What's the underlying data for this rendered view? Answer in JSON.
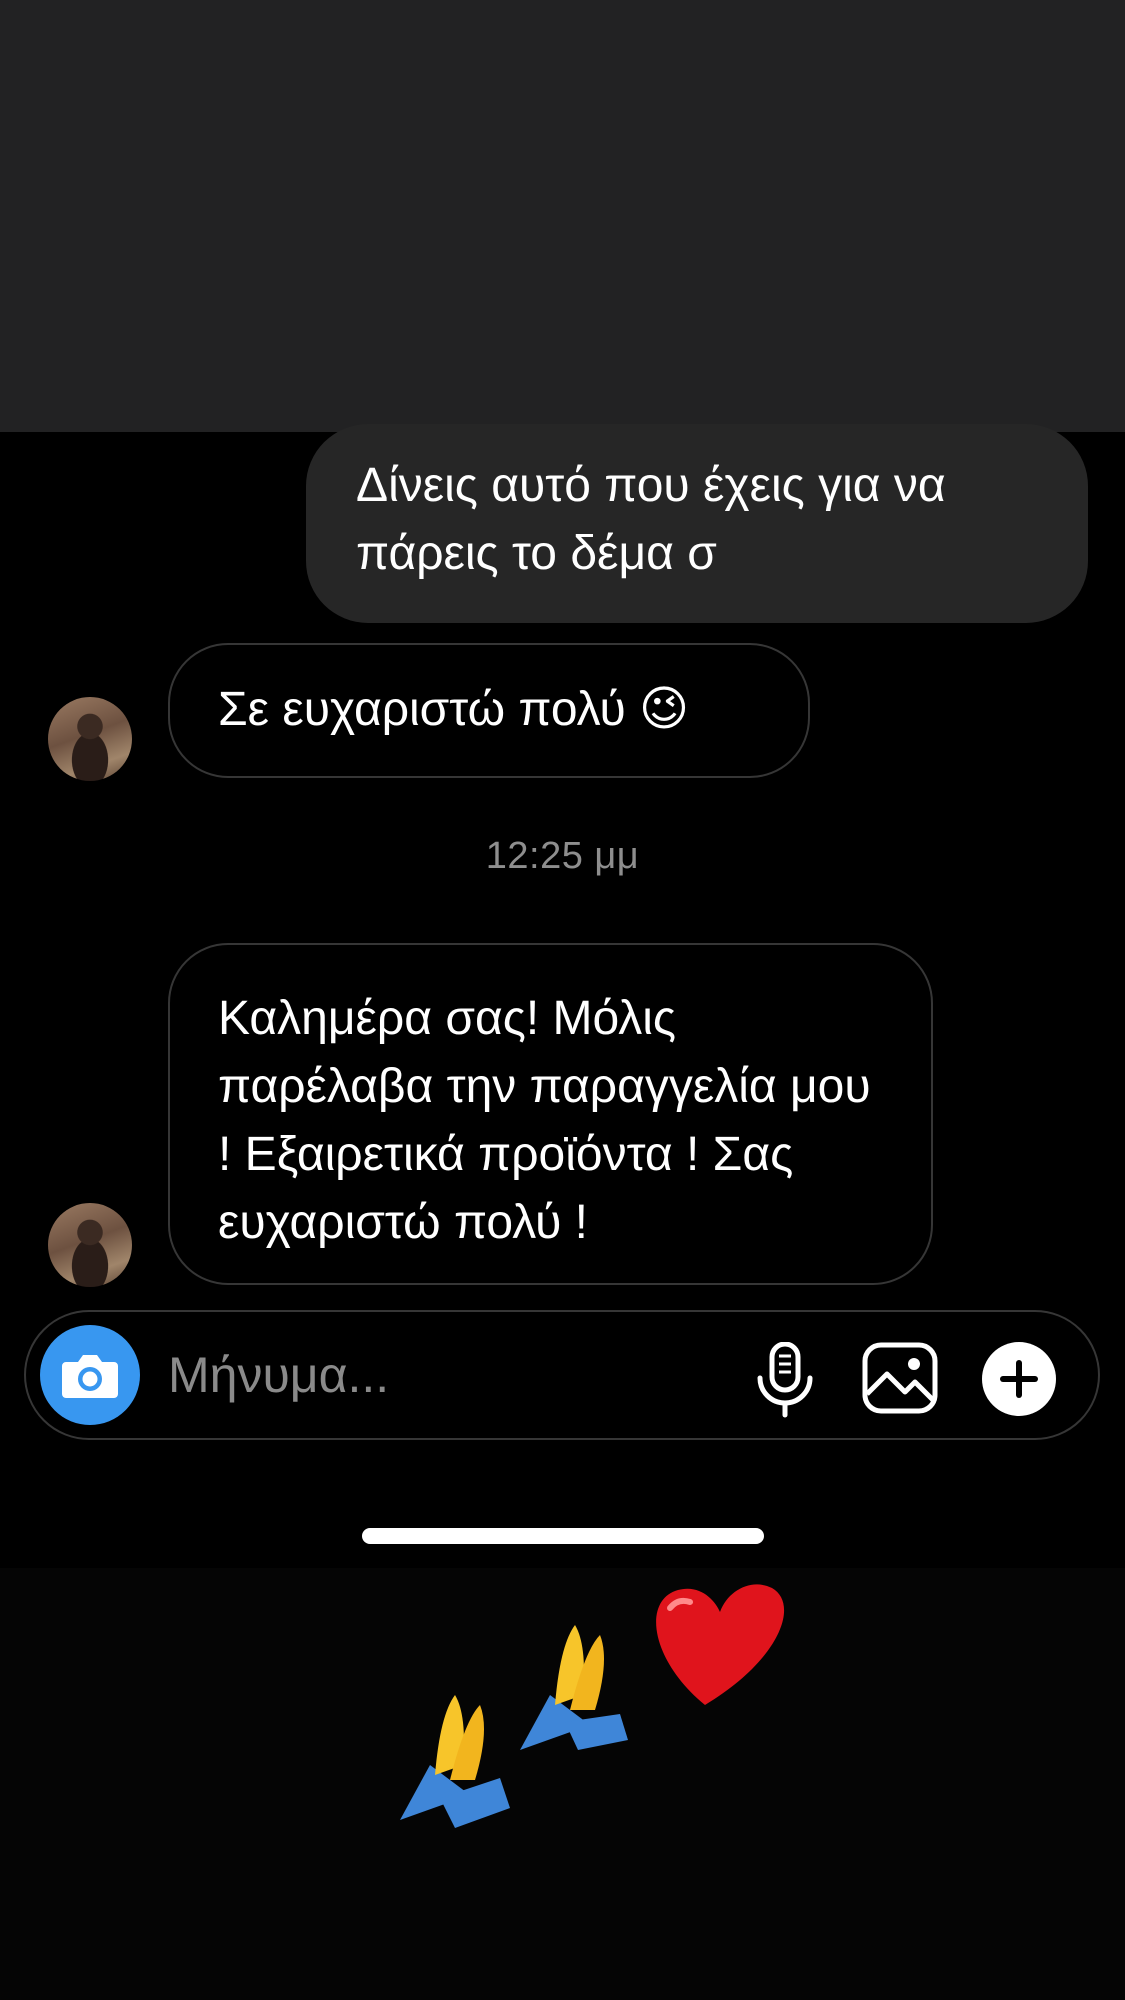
{
  "messages": [
    {
      "direction": "outgoing",
      "text": "Δίνεις αυτό που έχεις για να πάρεις το δέμα σ"
    },
    {
      "direction": "incoming",
      "text": "Σε ευχαριστώ πολύ 😉"
    },
    {
      "direction": "incoming",
      "text": "Καλημέρα σας! Μόλις παρέλαβα την παραγγελία μου ! Εξαιρετικά προϊόντα ! Σας ευχαριστώ πολύ !"
    }
  ],
  "timestamp": "12:25 μμ",
  "composer": {
    "placeholder": "Μήνυμα...",
    "camera_icon": "camera-icon",
    "mic_icon": "microphone-icon",
    "gallery_icon": "image-gallery-icon",
    "plus_icon": "plus-icon"
  },
  "overlay_emoji": [
    "praying-hands",
    "praying-hands",
    "red-heart"
  ],
  "colors": {
    "top_area": "#222223",
    "chat_background": "#000000",
    "outgoing_bubble": "#262626",
    "incoming_border": "#363636",
    "camera_button": "#3897f0",
    "timestamp": "#8e8e8e"
  }
}
